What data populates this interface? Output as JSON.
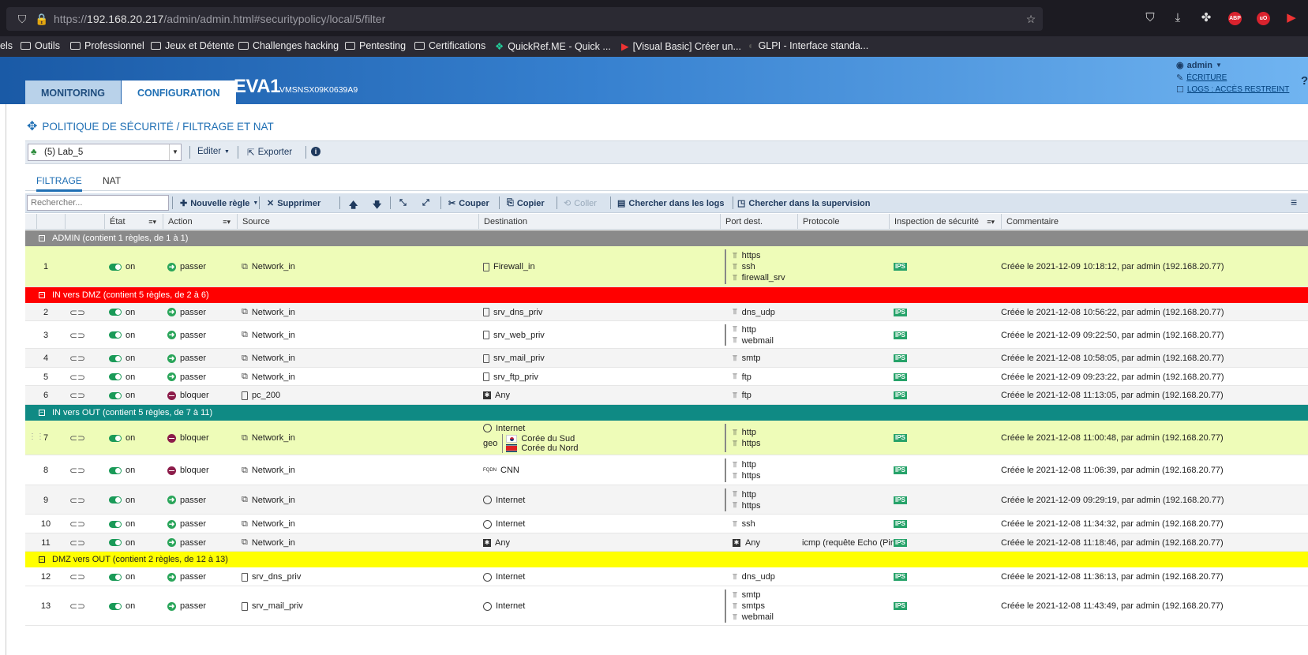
{
  "browser": {
    "url_prefix": "https://",
    "url_host": "192.168.20.217",
    "url_path": "/admin/admin.html#securitypolicy/local/5/filter",
    "bookmarks": [
      "els",
      "Outils",
      "Professionnel",
      "Jeux et Détente",
      "Challenges hacking",
      "Pentesting",
      "Certifications",
      "QuickRef.ME - Quick ...",
      "[Visual Basic] Créer un...",
      "GLPI - Interface standa..."
    ],
    "ext_abp": "ABP",
    "ext_ub": "uO"
  },
  "header": {
    "tab_monitoring": "MONITORING",
    "tab_configuration": "CONFIGURATION",
    "fw_name": "EVA1",
    "fw_serial": "VMSNSX09K0639A9",
    "user": "admin",
    "write_mode": "ÉCRITURE",
    "logs_access": "LOGS : ACCÈS RESTREINT",
    "help": "?"
  },
  "page": {
    "title": "POLITIQUE DE SÉCURITÉ / FILTRAGE ET NAT"
  },
  "toolbar1": {
    "policy": "(5) Lab_5",
    "edit": "Editer",
    "export": "Exporter"
  },
  "subtabs": {
    "filtering": "FILTRAGE",
    "nat": "NAT"
  },
  "toolbar2": {
    "search_placeholder": "Rechercher...",
    "new_rule": "Nouvelle règle",
    "delete": "Supprimer",
    "cut": "Couper",
    "copy": "Copier",
    "paste": "Coller",
    "search_logs": "Chercher dans les logs",
    "search_supervision": "Chercher dans la supervision"
  },
  "columns": {
    "state": "État",
    "action": "Action",
    "source": "Source",
    "destination": "Destination",
    "port": "Port dest.",
    "protocol": "Protocole",
    "inspection": "Inspection de sécurité",
    "comment": "Commentaire"
  },
  "groups": [
    {
      "label": "ADMIN (contient 1 règles, de 1 à 1)",
      "color": "#8a8a8a",
      "text": "#fff"
    },
    {
      "label": "IN vers DMZ (contient 5 règles, de 2 à 6)",
      "color": "#ff0000",
      "text": "#fff"
    },
    {
      "label": "IN vers OUT (contient 5 règles, de 7 à 11)",
      "color": "#0f8a84",
      "text": "#fff"
    },
    {
      "label": "DMZ vers OUT (contient 2 règles, de 12 à 13)",
      "color": "#ffff00",
      "text": "#222"
    }
  ],
  "rules": [
    {
      "n": "1",
      "state": "on",
      "action": "passer",
      "src": "Network_in",
      "dst": "Firewall_in",
      "ports": [
        "https",
        "ssh",
        "firewall_srv"
      ],
      "proto": "",
      "ips": "IPS",
      "comment": "Créée le 2021-12-09 10:18:12, par admin (192.168.20.77)"
    },
    {
      "n": "2",
      "state": "on",
      "action": "passer",
      "src": "Network_in",
      "dst": "srv_dns_priv",
      "ports": [
        "dns_udp"
      ],
      "proto": "",
      "ips": "IPS",
      "comment": "Créée le 2021-12-08 10:56:22, par admin (192.168.20.77)"
    },
    {
      "n": "3",
      "state": "on",
      "action": "passer",
      "src": "Network_in",
      "dst": "srv_web_priv",
      "ports": [
        "http",
        "webmail"
      ],
      "proto": "",
      "ips": "IPS",
      "comment": "Créée le 2021-12-09 09:22:50, par admin (192.168.20.77)"
    },
    {
      "n": "4",
      "state": "on",
      "action": "passer",
      "src": "Network_in",
      "dst": "srv_mail_priv",
      "ports": [
        "smtp"
      ],
      "proto": "",
      "ips": "IPS",
      "comment": "Créée le 2021-12-08 10:58:05, par admin (192.168.20.77)"
    },
    {
      "n": "5",
      "state": "on",
      "action": "passer",
      "src": "Network_in",
      "dst": "srv_ftp_priv",
      "ports": [
        "ftp"
      ],
      "proto": "",
      "ips": "IPS",
      "comment": "Créée le 2021-12-09 09:23:22, par admin (192.168.20.77)"
    },
    {
      "n": "6",
      "state": "on",
      "action": "bloquer",
      "src": "pc_200",
      "dst": "Any",
      "ports": [
        "ftp"
      ],
      "proto": "",
      "ips": "IPS",
      "comment": "Créée le 2021-12-08 11:13:05, par admin (192.168.20.77)"
    },
    {
      "n": "7",
      "state": "on",
      "action": "bloquer",
      "src": "Network_in",
      "dst": "Internet",
      "geo": "geo",
      "geo_items": [
        "Corée du Sud",
        "Corée du Nord"
      ],
      "ports": [
        "http",
        "https"
      ],
      "proto": "",
      "ips": "IPS",
      "comment": "Créée le 2021-12-08 11:00:48, par admin (192.168.20.77)"
    },
    {
      "n": "8",
      "state": "on",
      "action": "bloquer",
      "src": "Network_in",
      "dst": "CNN",
      "ports": [
        "http",
        "https"
      ],
      "proto": "",
      "ips": "IPS",
      "comment": "Créée le 2021-12-08 11:06:39, par admin (192.168.20.77)"
    },
    {
      "n": "9",
      "state": "on",
      "action": "passer",
      "src": "Network_in",
      "dst": "Internet",
      "ports": [
        "http",
        "https"
      ],
      "proto": "",
      "ips": "IPS",
      "comment": "Créée le 2021-12-09 09:29:19, par admin (192.168.20.77)"
    },
    {
      "n": "10",
      "state": "on",
      "action": "passer",
      "src": "Network_in",
      "dst": "Internet",
      "ports": [
        "ssh"
      ],
      "proto": "",
      "ips": "IPS",
      "comment": "Créée le 2021-12-08 11:34:32, par admin (192.168.20.77)"
    },
    {
      "n": "11",
      "state": "on",
      "action": "passer",
      "src": "Network_in",
      "dst": "Any",
      "ports": [
        "Any"
      ],
      "proto": "icmp  (requête Echo (Pin",
      "ips": "IPS",
      "comment": "Créée le 2021-12-08 11:18:46, par admin (192.168.20.77)"
    },
    {
      "n": "12",
      "state": "on",
      "action": "passer",
      "src": "srv_dns_priv",
      "dst": "Internet",
      "ports": [
        "dns_udp"
      ],
      "proto": "",
      "ips": "IPS",
      "comment": "Créée le 2021-12-08 11:36:13, par admin (192.168.20.77)"
    },
    {
      "n": "13",
      "state": "on",
      "action": "passer",
      "src": "srv_mail_priv",
      "dst": "Internet",
      "ports": [
        "smtp",
        "smtps",
        "webmail"
      ],
      "proto": "",
      "ips": "IPS",
      "comment": "Créée le 2021-12-08 11:43:49, par admin (192.168.20.77)"
    }
  ]
}
